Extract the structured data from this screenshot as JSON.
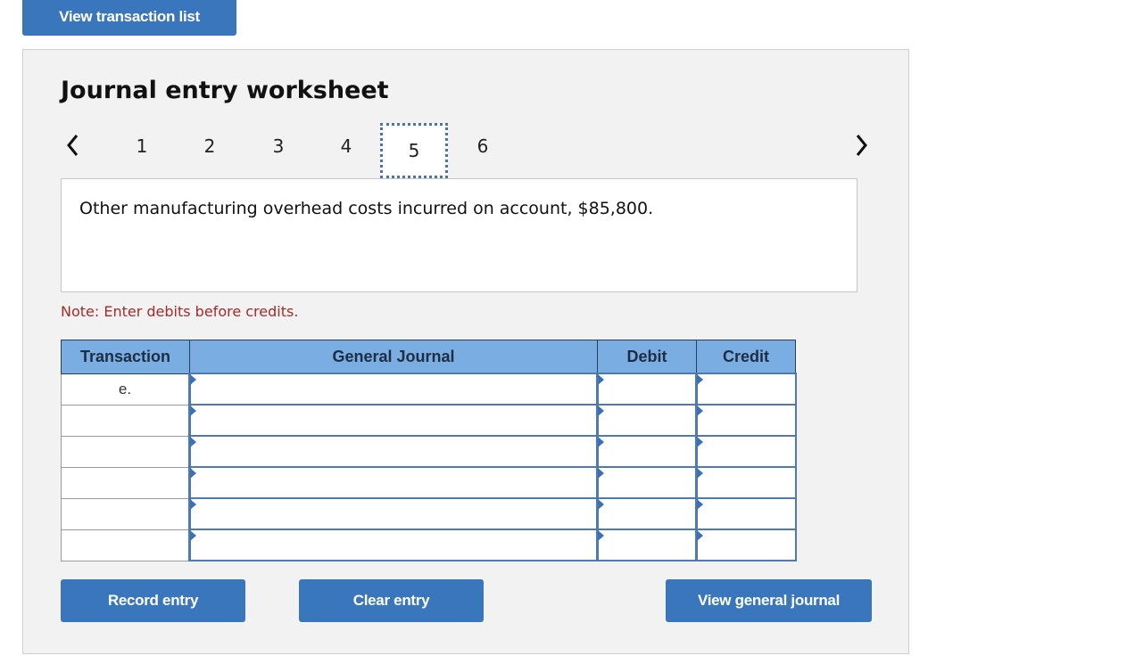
{
  "top_button": "View transaction list",
  "worksheet": {
    "title": "Journal entry worksheet",
    "prev_icon": "‹",
    "next_icon": "›",
    "pages": [
      "1",
      "2",
      "3",
      "4",
      "5",
      "6"
    ],
    "active_page": "5",
    "description": "Other manufacturing overhead costs incurred on account, $85,800.",
    "note": "Note: Enter debits before credits."
  },
  "table": {
    "headers": [
      "Transaction",
      "General Journal",
      "Debit",
      "Credit"
    ],
    "rows": [
      {
        "transaction": "e.",
        "account": "",
        "debit": "",
        "credit": ""
      },
      {
        "transaction": "",
        "account": "",
        "debit": "",
        "credit": ""
      },
      {
        "transaction": "",
        "account": "",
        "debit": "",
        "credit": ""
      },
      {
        "transaction": "",
        "account": "",
        "debit": "",
        "credit": ""
      },
      {
        "transaction": "",
        "account": "",
        "debit": "",
        "credit": ""
      },
      {
        "transaction": "",
        "account": "",
        "debit": "",
        "credit": ""
      }
    ]
  },
  "buttons": {
    "record": "Record entry",
    "clear": "Clear entry",
    "view_general_journal": "View general journal"
  },
  "colors": {
    "button": "#3a76bb",
    "header": "#7aaee2",
    "note": "#a52a2a"
  }
}
